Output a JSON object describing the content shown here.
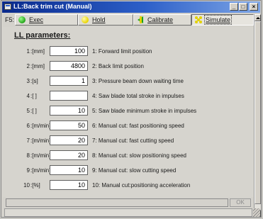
{
  "window": {
    "title": "LL:Back trim cut  (Manual)"
  },
  "toolbar": {
    "key_label": "F5:",
    "buttons": [
      {
        "label": "Exec",
        "icon": "green-circle-icon"
      },
      {
        "label": "Hold",
        "icon": "yellow-circle-icon"
      },
      {
        "label": "Calibrate",
        "icon": "calibrate-icon"
      },
      {
        "label": "Simulate",
        "icon": "simulate-icon"
      }
    ]
  },
  "params": {
    "heading": "LL parameters:",
    "rows": [
      {
        "num": "1",
        "unit": ":[mm]",
        "value": "100",
        "desc": "1: Forward limit position"
      },
      {
        "num": "2",
        "unit": ":[mm]",
        "value": "4800",
        "desc": "2: Back limit position"
      },
      {
        "num": "3",
        "unit": ":[s]",
        "value": "1",
        "desc": "3: Pressure beam down waiting time"
      },
      {
        "num": "4",
        "unit": ":[ ]",
        "value": "",
        "desc": "4: Saw blade total stroke in impulses"
      },
      {
        "num": "5",
        "unit": ":[ ]",
        "value": "10",
        "desc": "5: Saw blade minimum stroke in impulses"
      },
      {
        "num": "6",
        "unit": ":[m/min]",
        "value": "50",
        "desc": "6: Manual cut: fast positioning speed"
      },
      {
        "num": "7",
        "unit": ":[m/min]",
        "value": "20",
        "desc": "7: Manual cut: fast cutting speed"
      },
      {
        "num": "8",
        "unit": ":[m/min]",
        "value": "20",
        "desc": "8: Manual cut: slow positioning speed"
      },
      {
        "num": "9",
        "unit": ":[m/min]",
        "value": "10",
        "desc": "9: Manual cut: slow cutting speed"
      },
      {
        "num": "10",
        "unit": ":[%]",
        "value": "10",
        "desc": "10: Manual cut:positioning acceleration"
      }
    ]
  },
  "statusbar": {
    "ok_label": "OK"
  },
  "colors": {
    "titlebar": "#0a2a8c",
    "window": "#d4d2cc"
  }
}
